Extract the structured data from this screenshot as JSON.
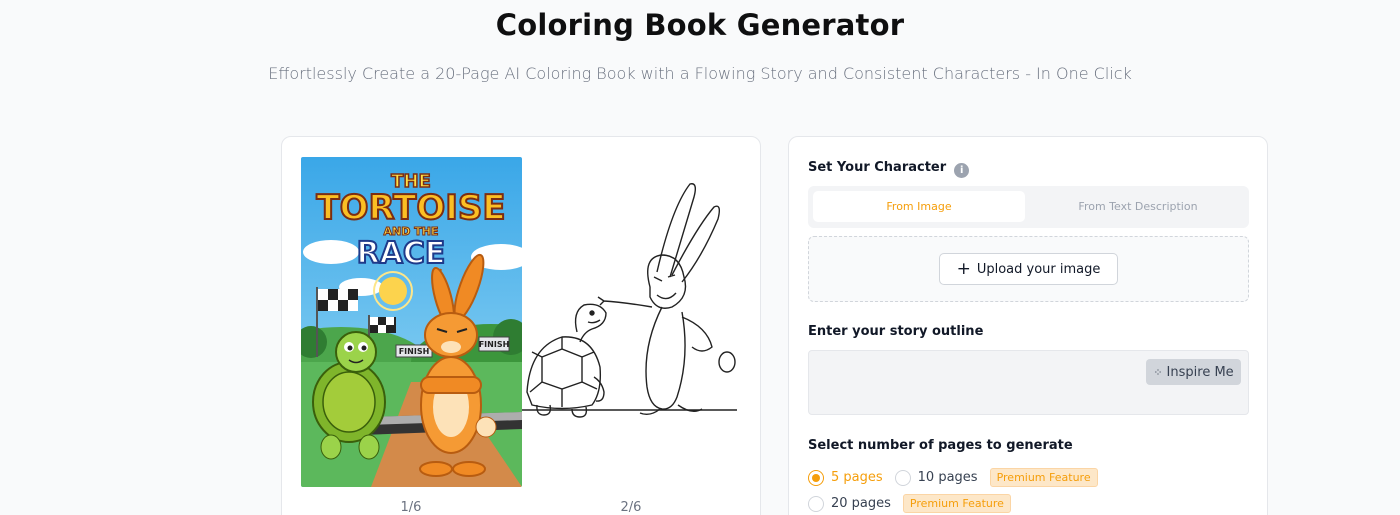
{
  "header": {
    "title": "Coloring Book Generator",
    "subtitle": "Effortlessly Create a 20-Page AI Coloring Book with a Flowing Story and Consistent Characters - In One Click"
  },
  "preview": {
    "cover_lines": [
      "THE",
      "TORTOISE",
      "AND THE",
      "RACE"
    ],
    "cover_finish_signs": [
      "FINISH",
      "FINISH"
    ],
    "page_labels": [
      "1/6",
      "2/6"
    ]
  },
  "character": {
    "label": "Set Your Character",
    "info_icon": "i",
    "tabs": [
      "From Image",
      "From Text Description"
    ],
    "upload_label": "Upload your image",
    "upload_icon": "+"
  },
  "story": {
    "label": "Enter your story outline",
    "inspire_label": "Inspire Me",
    "inspire_icon": "⁘"
  },
  "pages": {
    "label": "Select number of pages to generate",
    "options": [
      {
        "label": "5 pages",
        "selected": true,
        "premium": ""
      },
      {
        "label": "10 pages",
        "selected": false,
        "premium": "Premium Feature"
      },
      {
        "label": "20 pages",
        "selected": false,
        "premium": "Premium Feature"
      }
    ]
  },
  "colors": {
    "accent": "#f59e0b",
    "background": "#f9fafb",
    "card": "#ffffff"
  }
}
